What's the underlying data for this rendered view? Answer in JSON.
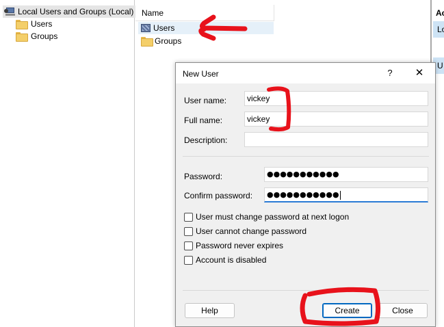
{
  "tree": {
    "root_label": "Local Users and Groups (Local)",
    "items": [
      {
        "label": "Users",
        "icon": "folder-icon"
      },
      {
        "label": "Groups",
        "icon": "folder-icon"
      }
    ]
  },
  "list": {
    "header": "Name",
    "rows": [
      {
        "label": "Users",
        "icon": "users-icon",
        "selected": true
      },
      {
        "label": "Groups",
        "icon": "folder-icon",
        "selected": false
      }
    ]
  },
  "right_pane": {
    "header": "Ac",
    "row1": "Lo",
    "row2": "U"
  },
  "dialog": {
    "title": "New User",
    "help_glyph": "?",
    "close_glyph": "✕",
    "fields": {
      "username_label": "User name:",
      "username_value": "vickey",
      "fullname_label": "Full name:",
      "fullname_value": "vickey",
      "description_label": "Description:",
      "description_value": "",
      "password_label": "Password:",
      "password_value": "●●●●●●●●●●●",
      "confirm_label": "Confirm password:",
      "confirm_value": "●●●●●●●●●●●"
    },
    "checkboxes": [
      {
        "label": "User must change password at next logon",
        "checked": false
      },
      {
        "label": "User cannot change password",
        "checked": false
      },
      {
        "label": "Password never expires",
        "checked": false
      },
      {
        "label": "Account is disabled",
        "checked": false
      }
    ],
    "buttons": {
      "help": "Help",
      "create": "Create",
      "close": "Close"
    }
  },
  "colors": {
    "annotation": "#e8121b",
    "accent": "#0067c0",
    "selection": "#e5f0f9"
  }
}
